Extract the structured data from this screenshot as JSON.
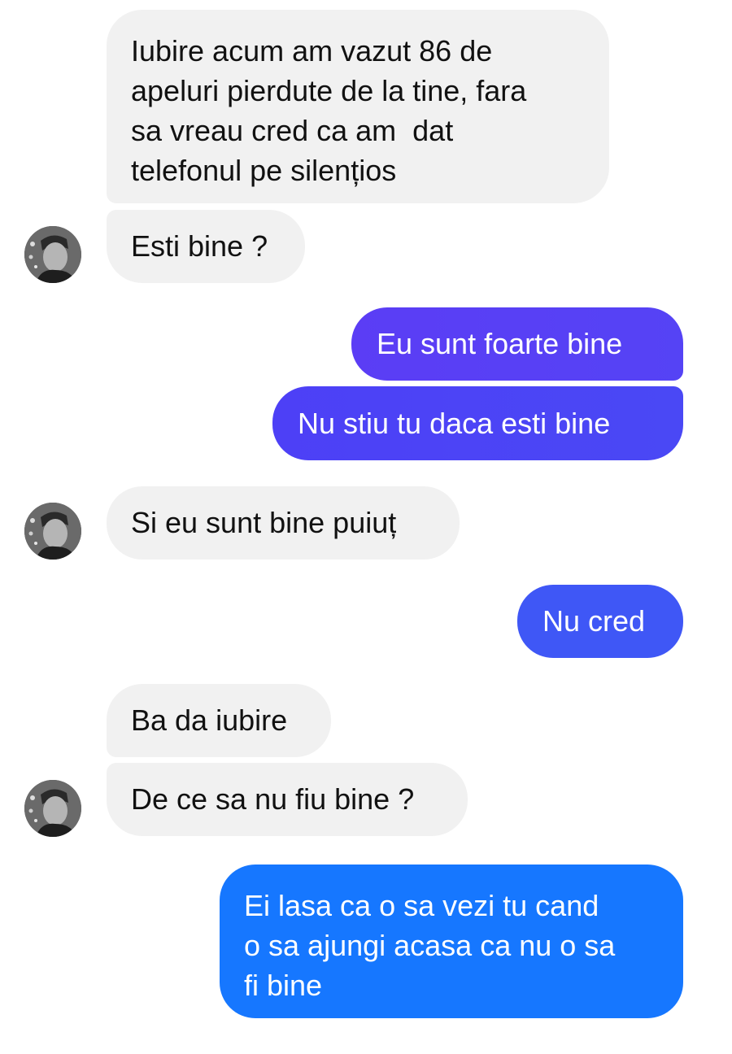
{
  "messages": [
    {
      "from": "them",
      "text": "Iubire acum am vazut 86 de\napeluri pierdute de la tine, fara\nsa vreau cred ca am  dat\ntelefonul pe silențios"
    },
    {
      "from": "them",
      "text": "Esti bine ?"
    },
    {
      "from": "me",
      "text": "Eu sunt foarte bine"
    },
    {
      "from": "me",
      "text": "Nu stiu tu daca esti bine"
    },
    {
      "from": "them",
      "text": "Si eu sunt bine puiuț"
    },
    {
      "from": "me",
      "text": "Nu cred"
    },
    {
      "from": "them",
      "text": "Ba da iubire"
    },
    {
      "from": "them",
      "text": "De ce sa nu fiu bine ?"
    },
    {
      "from": "me",
      "text": "Ei lasa ca o sa vezi tu cand\no sa ajungi acasa ca nu o sa\nfi bine"
    }
  ],
  "avatar_icon": "person-photo-avatar",
  "colors": {
    "incoming_bg": "#f1f1f1",
    "incoming_text": "#111111",
    "outgoing_text": "#ffffff",
    "outgoing_purple": "#5b3df5",
    "outgoing_indigo": "#4a44f5",
    "outgoing_blue": "#1677ff"
  }
}
